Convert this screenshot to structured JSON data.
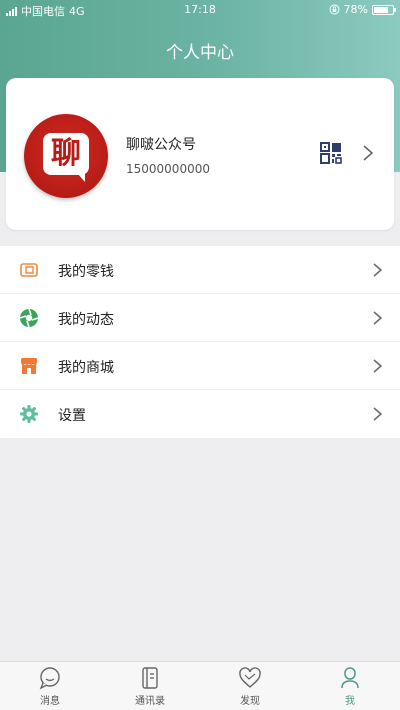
{
  "status_bar": {
    "carrier": "中国电信",
    "network": "4G",
    "time": "17:18",
    "battery": "78%",
    "battery_level": 0.78
  },
  "header": {
    "title": "个人中心"
  },
  "profile": {
    "avatar_text": "聊",
    "name": "聊啵公众号",
    "phone": "15000000000",
    "qr_icon": "qr-code-icon",
    "chevron_icon": "chevron-right-icon"
  },
  "menu": {
    "items": [
      {
        "label": "我的零钱",
        "icon": "wallet-icon",
        "color": "#f08a3c"
      },
      {
        "label": "我的动态",
        "icon": "aperture-icon",
        "color": "#3aa45a"
      },
      {
        "label": "我的商城",
        "icon": "store-icon",
        "color": "#f07a35"
      },
      {
        "label": "设置",
        "icon": "gear-icon",
        "color": "#5cbf9c"
      }
    ]
  },
  "tabbar": {
    "tabs": [
      {
        "label": "消息",
        "icon": "chat-bubble-icon",
        "active": false
      },
      {
        "label": "通讯录",
        "icon": "contacts-book-icon",
        "active": false
      },
      {
        "label": "发现",
        "icon": "heart-icon",
        "active": false
      },
      {
        "label": "我",
        "icon": "person-icon",
        "active": true
      }
    ]
  },
  "colors": {
    "accent": "#4c9b8a",
    "header_gradient_start": "#5aa691",
    "header_gradient_end": "#8ccac0"
  }
}
